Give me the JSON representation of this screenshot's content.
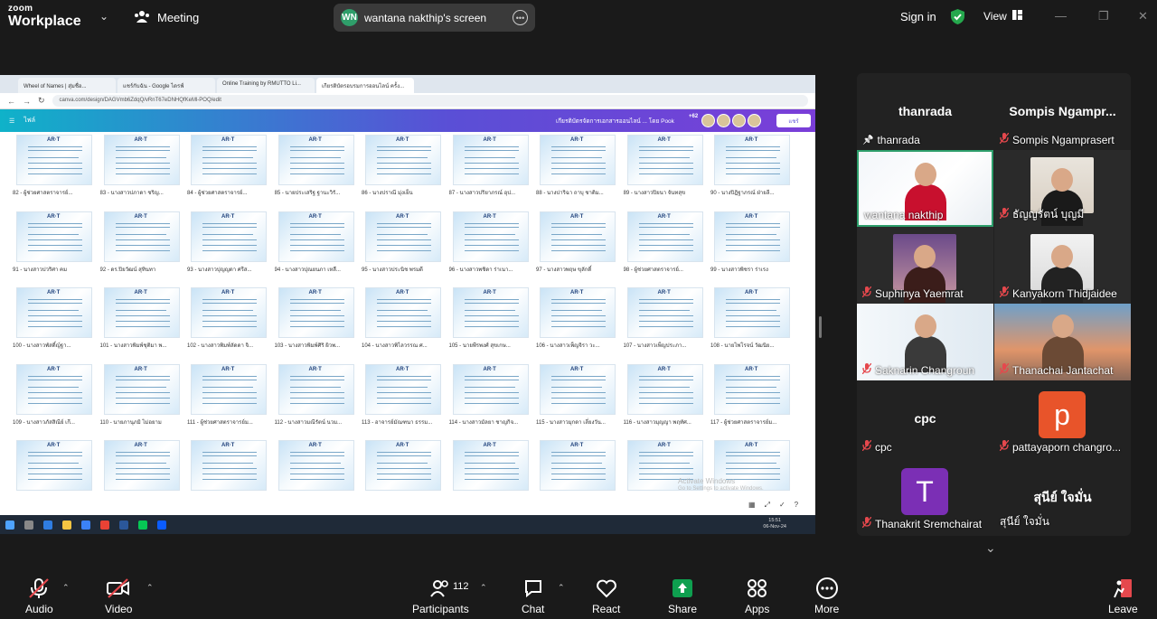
{
  "app": {
    "logo_line1": "zoom",
    "logo_line2": "Workplace",
    "meeting_label": "Meeting",
    "sign_in": "Sign in",
    "view_label": "View"
  },
  "share_pill": {
    "badge": "WN",
    "title": "wantana nakthip's screen"
  },
  "browser": {
    "tabs": [
      "Wheel of Names | สุ่มชื่อ...",
      "แชร์กับฉัน - Google ไดรฟ์",
      "Online Training by RMUTTO Li...",
      "เกียรติบัตรอบรมการออนไลน์ ครั้ง..."
    ],
    "url": "canva.com/design/DAGVmb6ZdqQ/vRnT67eDNHQfKeMl-POQ/edit"
  },
  "canva": {
    "menu_file": "ไฟล์",
    "title": "เกียรติบัตรจัดการเอกสารออนไลน์ ...",
    "owner": "โดย Pook",
    "plus_count": "+62",
    "share_btn": "แชร์"
  },
  "certificates": [
    {
      "label": "82 - ผู้ช่วยศาสตราจารย์..."
    },
    {
      "label": "83 - นางสาวปภาดา ชริญ..."
    },
    {
      "label": "84 - ผู้ช่วยศาสตราจารย์..."
    },
    {
      "label": "85 - นายประเสริฐ ฐานะวิรั..."
    },
    {
      "label": "86 - นางปราณี มุ่งเย็น"
    },
    {
      "label": "87 - นางสาวปริยาภรณ์ อุป..."
    },
    {
      "label": "88 - นางปาริฉา ถาบุ ชาติม..."
    },
    {
      "label": "89 - นางสาวปิยนา จันทสุข"
    },
    {
      "label": "90 - นางปิฎิฐาภรณ์ ฝ่ายลี..."
    },
    {
      "label": "91 - นางสาวปวริศา คม"
    },
    {
      "label": "92 - ดร.ปิยวัฒน์ สุทินทา"
    },
    {
      "label": "93 - นางสาวปุญญดา ศรีส..."
    },
    {
      "label": "94 - นางสาวปุณยนภา เหลื..."
    },
    {
      "label": "95 - นางสาวประนิช พรมดี"
    },
    {
      "label": "96 - นางสาวพชิดา ร่าเนา..."
    },
    {
      "label": "97 - นางสาวพฤษ ขุลักดิ์"
    },
    {
      "label": "98 - ผู้ช่วยศาสตราจารย์..."
    },
    {
      "label": "99 - นางสาวพิชรา ร่าเรง"
    },
    {
      "label": "100 - นางสาวพัสดิ์ญ์ฐา..."
    },
    {
      "label": "101 - นางสาวพิมพ์ชุติมา พ..."
    },
    {
      "label": "102 - นางสาวพิมพ์ลัดดา จิ..."
    },
    {
      "label": "103 - นางสาวพิมพ์ศิริ ผิวพ..."
    },
    {
      "label": "104 - นางสาวพิไลวรรณ ศ..."
    },
    {
      "label": "105 - นายพีรพงศ์ สุขเกษ..."
    },
    {
      "label": "106 - นางสาวเพ็ญจิรา วะ..."
    },
    {
      "label": "107 - นางสาวเพ็ญประภา..."
    },
    {
      "label": "108 - นายไพโรจน์ วัฒนิย..."
    },
    {
      "label": "109 - นางสาวภัสสิณีย์ เกี..."
    },
    {
      "label": "110 - นายภานุภมิ ไม่อยาม"
    },
    {
      "label": "111 - ผู้ช่วยศาสตราจารย์ม..."
    },
    {
      "label": "112 - นางสาวมณีรัตน์ นวม..."
    },
    {
      "label": "113 - อาจารย์มัณฑนา ธรรม..."
    },
    {
      "label": "114 - นางสาวมัลยา ชาญกิจ..."
    },
    {
      "label": "115 - นางสาวมุกดา เลี่ยงวัน..."
    },
    {
      "label": "116 - นางสาวมุญญา พฤทัศ..."
    },
    {
      "label": "117 - ผู้ช่วยศาสตราจารย์ม..."
    },
    {
      "label": ""
    },
    {
      "label": ""
    },
    {
      "label": ""
    },
    {
      "label": ""
    },
    {
      "label": ""
    },
    {
      "label": ""
    },
    {
      "label": ""
    },
    {
      "label": ""
    },
    {
      "label": ""
    }
  ],
  "cert_logo": "AR·T",
  "activate": {
    "line1": "Activate Windows",
    "line2": "Go to Settings to activate Windows."
  },
  "taskbar_clock": {
    "time": "15:51",
    "date": "06-Nov-24"
  },
  "participants": [
    {
      "name": "thanrada",
      "label": "thanrada",
      "icon": "pin",
      "video": false
    },
    {
      "name": "Sompis Ngampr...",
      "label": "Sompis Ngamprasert",
      "icon": "mic-off",
      "video": false
    },
    {
      "name": "",
      "label": "wantana nakthip",
      "icon": "none",
      "video": true,
      "highlight": true
    },
    {
      "name": "",
      "label": "ธัญญรัตน์ บุญมี",
      "icon": "mic-off",
      "video": true
    },
    {
      "name": "",
      "label": "Suphinya Yaemrat",
      "icon": "mic-off",
      "video": true
    },
    {
      "name": "",
      "label": "Kanyakorn Thidjaidee",
      "icon": "mic-off",
      "video": true
    },
    {
      "name": "",
      "label": "Saknarin Changroun",
      "icon": "mic-off",
      "video": true
    },
    {
      "name": "",
      "label": "Thanachai Jantachat",
      "icon": "mic-off",
      "video": true
    },
    {
      "name": "cpc",
      "label": "cpc",
      "icon": "mic-off",
      "video": false
    },
    {
      "name": "",
      "label": "pattayaporn changro...",
      "icon": "mic-off",
      "video": false,
      "avatar": "p",
      "avatar_color": "#e8542a"
    },
    {
      "name": "",
      "label": "Thanakrit Sremchairat",
      "icon": "mic-off",
      "video": false,
      "avatar": "T",
      "avatar_color": "#7b2fb5"
    },
    {
      "name": "สุนีย์ ใจมั่น",
      "label": "สุนีย์ ใจมั่น",
      "icon": "none",
      "video": false
    }
  ],
  "toolbar": {
    "audio": "Audio",
    "video": "Video",
    "participants": "Participants",
    "participants_count": "112",
    "chat": "Chat",
    "react": "React",
    "share": "Share",
    "apps": "Apps",
    "more": "More",
    "leave": "Leave"
  },
  "colors": {
    "share_green": "#0e9f4f",
    "mute_red": "#e5484d",
    "highlight": "#2d9e6b"
  }
}
